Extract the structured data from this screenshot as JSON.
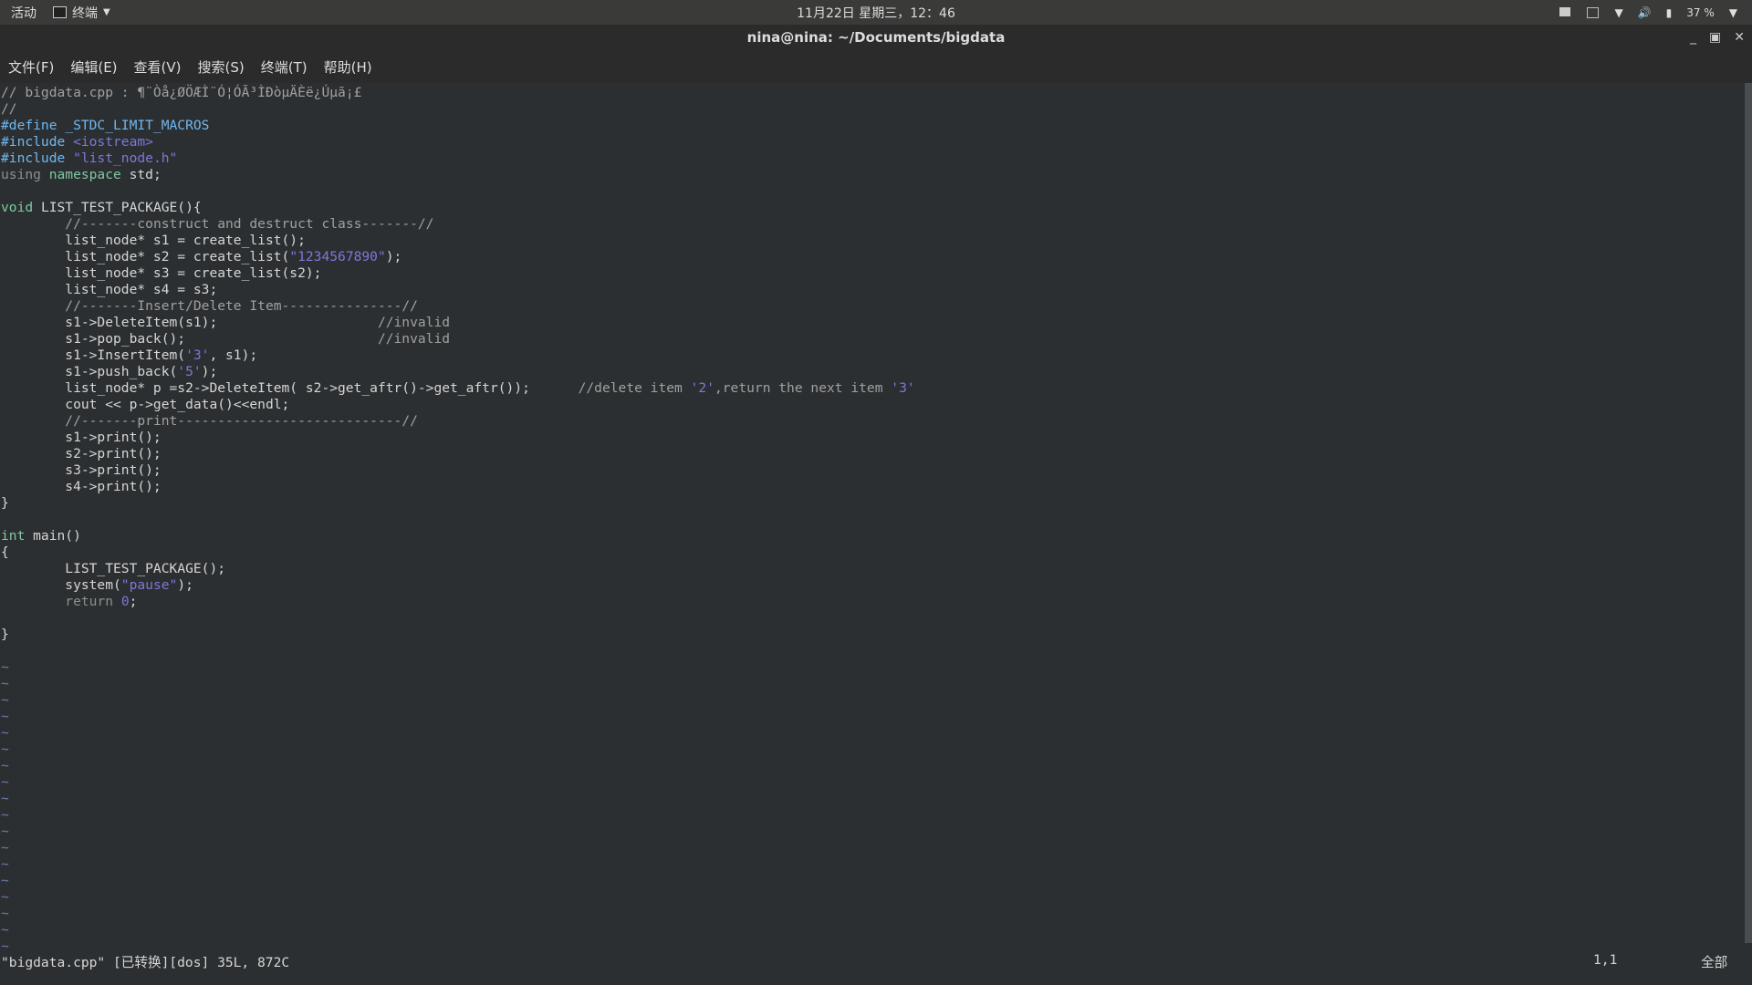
{
  "topbar": {
    "activities": "活动",
    "app_name": "终端",
    "datetime": "11月22日 星期三，12：46",
    "battery": "37 %"
  },
  "window": {
    "title": "nina@nina: ~/Documents/bigdata"
  },
  "menubar": {
    "file": "文件(F)",
    "edit": "编辑(E)",
    "view": "查看(V)",
    "search": "搜索(S)",
    "terminal": "终端(T)",
    "help": "帮助(H)"
  },
  "editor": {
    "lines": [
      [
        {
          "c": "cm",
          "t": "// bigdata.cpp : ¶¨Òå¿ØÖÆÌ¨Ó¦ÓÃ³ÌÐòµÄÈë¿Úµã¡£"
        }
      ],
      [
        {
          "c": "cm",
          "t": "//"
        }
      ],
      [
        {
          "c": "pp",
          "t": "#define _STDC_LIMIT_MACROS"
        }
      ],
      [
        {
          "c": "pp",
          "t": "#include "
        },
        {
          "c": "st",
          "t": "<iostream>"
        }
      ],
      [
        {
          "c": "pp",
          "t": "#include "
        },
        {
          "c": "st",
          "t": "\"list_node.h\""
        }
      ],
      [
        {
          "c": "gr",
          "t": "using "
        },
        {
          "c": "kw",
          "t": "namespace"
        },
        {
          "c": "",
          "t": " std;"
        }
      ],
      [
        {
          "c": "",
          "t": ""
        }
      ],
      [
        {
          "c": "kw",
          "t": "void"
        },
        {
          "c": "",
          "t": " LIST_TEST_PACKAGE(){"
        }
      ],
      [
        {
          "c": "",
          "t": "        "
        },
        {
          "c": "cm",
          "t": "//-------construct and destruct class-------//"
        }
      ],
      [
        {
          "c": "",
          "t": "        list_node* s1 = create_list();"
        }
      ],
      [
        {
          "c": "",
          "t": "        list_node* s2 = create_list("
        },
        {
          "c": "st",
          "t": "\"1234567890\""
        },
        {
          "c": "",
          "t": ");"
        }
      ],
      [
        {
          "c": "",
          "t": "        list_node* s3 = create_list(s2);"
        }
      ],
      [
        {
          "c": "",
          "t": "        list_node* s4 = s3;"
        }
      ],
      [
        {
          "c": "",
          "t": "        "
        },
        {
          "c": "cm",
          "t": "//-------Insert/Delete Item---------------//"
        }
      ],
      [
        {
          "c": "",
          "t": "        s1->DeleteItem(s1);                    "
        },
        {
          "c": "cm",
          "t": "//invalid"
        }
      ],
      [
        {
          "c": "",
          "t": "        s1->pop_back();                        "
        },
        {
          "c": "cm",
          "t": "//invalid"
        }
      ],
      [
        {
          "c": "",
          "t": "        s1->InsertItem("
        },
        {
          "c": "st",
          "t": "'3'"
        },
        {
          "c": "",
          "t": ", s1);"
        }
      ],
      [
        {
          "c": "",
          "t": "        s1->push_back("
        },
        {
          "c": "st",
          "t": "'5'"
        },
        {
          "c": "",
          "t": ");"
        }
      ],
      [
        {
          "c": "",
          "t": "        list_node* p =s2->DeleteItem( s2->get_aftr()->get_aftr());      "
        },
        {
          "c": "cm",
          "t": "//delete item "
        },
        {
          "c": "st",
          "t": "'2'"
        },
        {
          "c": "cm",
          "t": ",return the next item "
        },
        {
          "c": "st",
          "t": "'3'"
        }
      ],
      [
        {
          "c": "",
          "t": "        cout << p->get_data()<<endl;"
        }
      ],
      [
        {
          "c": "",
          "t": "        "
        },
        {
          "c": "cm",
          "t": "//-------print----------------------------//"
        }
      ],
      [
        {
          "c": "",
          "t": "        s1->print();"
        }
      ],
      [
        {
          "c": "",
          "t": "        s2->print();"
        }
      ],
      [
        {
          "c": "",
          "t": "        s3->print();"
        }
      ],
      [
        {
          "c": "",
          "t": "        s4->print();"
        }
      ],
      [
        {
          "c": "",
          "t": "}"
        }
      ],
      [
        {
          "c": "",
          "t": ""
        }
      ],
      [
        {
          "c": "kw",
          "t": "int"
        },
        {
          "c": "",
          "t": " main()"
        }
      ],
      [
        {
          "c": "",
          "t": "{"
        }
      ],
      [
        {
          "c": "",
          "t": "        LIST_TEST_PACKAGE();"
        }
      ],
      [
        {
          "c": "",
          "t": "        system("
        },
        {
          "c": "st",
          "t": "\"pause\""
        },
        {
          "c": "",
          "t": ");"
        }
      ],
      [
        {
          "c": "",
          "t": "        "
        },
        {
          "c": "gr",
          "t": "return "
        },
        {
          "c": "st",
          "t": "0"
        },
        {
          "c": "",
          "t": ";"
        }
      ],
      [
        {
          "c": "",
          "t": ""
        }
      ],
      [
        {
          "c": "",
          "t": "}"
        }
      ],
      [
        {
          "c": "",
          "t": ""
        }
      ],
      [
        {
          "c": "tilde",
          "t": "~"
        }
      ],
      [
        {
          "c": "tilde",
          "t": "~"
        }
      ],
      [
        {
          "c": "tilde",
          "t": "~"
        }
      ],
      [
        {
          "c": "tilde",
          "t": "~"
        }
      ],
      [
        {
          "c": "tilde",
          "t": "~"
        }
      ],
      [
        {
          "c": "tilde",
          "t": "~"
        }
      ],
      [
        {
          "c": "tilde",
          "t": "~"
        }
      ],
      [
        {
          "c": "tilde",
          "t": "~"
        }
      ],
      [
        {
          "c": "tilde",
          "t": "~"
        }
      ],
      [
        {
          "c": "tilde",
          "t": "~"
        }
      ],
      [
        {
          "c": "tilde",
          "t": "~"
        }
      ],
      [
        {
          "c": "tilde",
          "t": "~"
        }
      ],
      [
        {
          "c": "tilde",
          "t": "~"
        }
      ],
      [
        {
          "c": "tilde",
          "t": "~"
        }
      ],
      [
        {
          "c": "tilde",
          "t": "~"
        }
      ],
      [
        {
          "c": "tilde",
          "t": "~"
        }
      ],
      [
        {
          "c": "tilde",
          "t": "~"
        }
      ],
      [
        {
          "c": "tilde",
          "t": "~"
        }
      ]
    ],
    "status_message": "\"bigdata.cpp\" [已转换][dos] 35L, 872C",
    "cursor_position": "1,1",
    "scroll_position": "全部"
  },
  "colors": {
    "background": "#2c2f31",
    "preprocessor": "#6fb8f2",
    "string": "#7b78d9",
    "keyword": "#7fc8a0",
    "comment": "#a0a0a0",
    "tilde": "#6a7ab0"
  },
  "icons": [
    "terminal-icon",
    "caret-down-icon",
    "screen-indicator-icon",
    "window-indicator-icon",
    "wifi-icon",
    "volume-icon",
    "battery-icon",
    "minimize-icon",
    "maximize-icon",
    "close-icon"
  ]
}
